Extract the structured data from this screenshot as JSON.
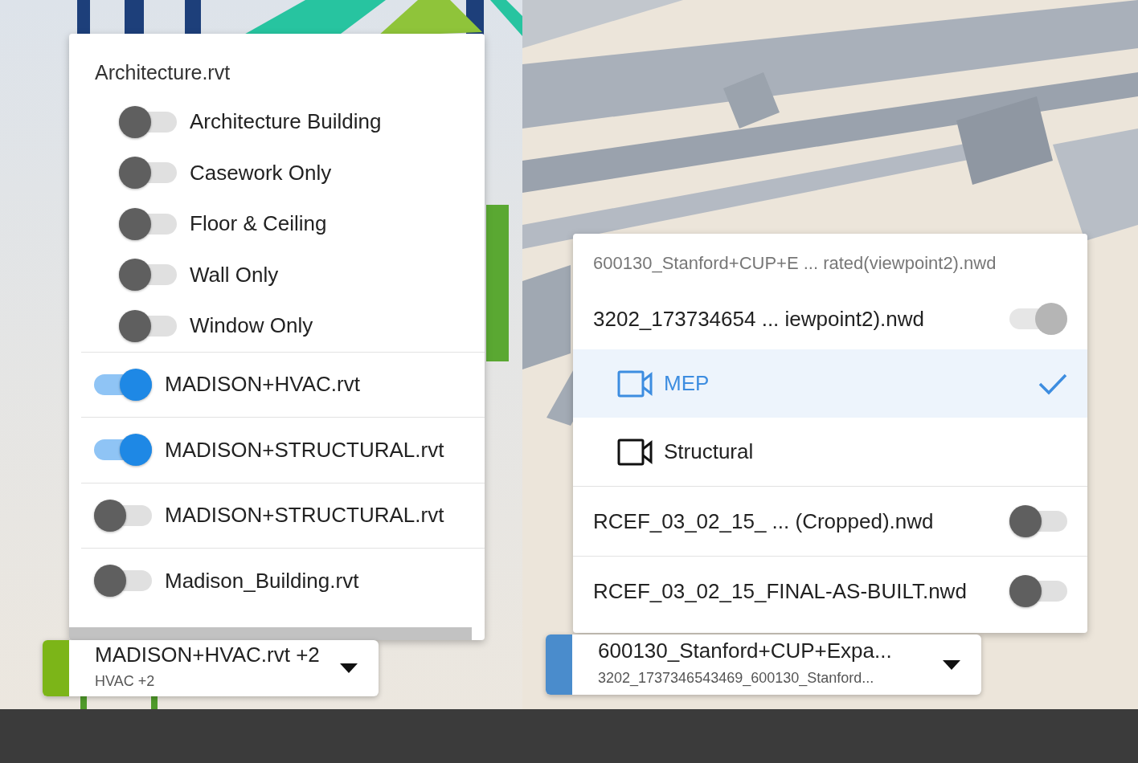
{
  "left_panel": {
    "menu": {
      "items": [
        {
          "kind": "group",
          "label": "Architecture.rvt",
          "children": [
            {
              "label": "Architecture Building",
              "on": false
            },
            {
              "label": "Casework Only",
              "on": false
            },
            {
              "label": "Floor & Ceiling",
              "on": false
            },
            {
              "label": "Wall Only",
              "on": false
            },
            {
              "label": "Window Only",
              "on": false
            }
          ]
        },
        {
          "kind": "file",
          "label": "MADISON+HVAC.rvt",
          "on": true
        },
        {
          "kind": "file",
          "label": "MADISON+STRUCTURAL.rvt",
          "on": true
        },
        {
          "kind": "file",
          "label": "MADISON+STRUCTURAL.rvt",
          "on": false
        },
        {
          "kind": "file",
          "label": "Madison_Building.rvt",
          "on": false
        }
      ]
    },
    "selector": {
      "title": "MADISON+HVAC.rvt +2",
      "subtitle": "HVAC +2",
      "color": "#7cb518"
    }
  },
  "right_panel": {
    "menu": {
      "items": [
        {
          "kind": "header",
          "label": "600130_Stanford+CUP+E ... rated(viewpoint2).nwd"
        },
        {
          "kind": "file",
          "label": "3202_173734654 ... iewpoint2).nwd",
          "on": true,
          "disabled": true,
          "children": [
            {
              "label": "MEP",
              "selected": true
            },
            {
              "label": "Structural",
              "selected": false
            }
          ]
        },
        {
          "kind": "file",
          "label": "RCEF_03_02_15_ ... (Cropped).nwd",
          "on": false,
          "disabled": false
        },
        {
          "kind": "file",
          "label": "RCEF_03_02_15_FINAL-AS-BUILT.nwd",
          "on": false,
          "disabled": false
        }
      ]
    },
    "selector": {
      "title": "600130_Stanford+CUP+Expa...",
      "subtitle": "3202_1737346543469_600130_Stanford...",
      "color": "#4a8ccc"
    }
  }
}
